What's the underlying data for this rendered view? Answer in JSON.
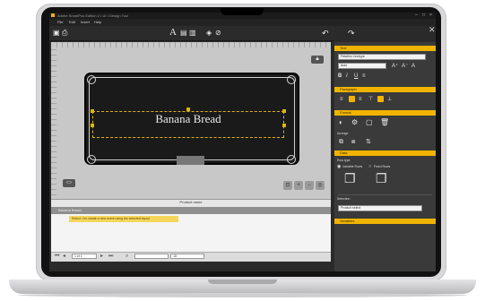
{
  "window": {
    "title": "Adobe SmartPos Edition 2 • UI • Design Tool"
  },
  "menu": {
    "items": [
      "File",
      "Edit",
      "Insert",
      "Help"
    ]
  },
  "label": {
    "text": "Banana Bread"
  },
  "product_panel": {
    "title": "Product name",
    "row": "Banana Bread",
    "hint": "Select • for create a new event using the selected layout"
  },
  "pager": {
    "page": "1 of 1",
    "field": "18"
  },
  "right_panel": {
    "sections": [
      "Text",
      "Paragraph",
      "Format",
      "Data",
      "Variables"
    ],
    "font_family": "Palatino Linotype",
    "font_size": "Auto",
    "arrange_label": "Arrange",
    "row_type_label": "Row type",
    "variable_rows_label": "Variable Rows",
    "fixed_rows_label": "Fixed Rows",
    "selection_label": "Selection",
    "selection_value": "Product select"
  },
  "colors": {
    "accent": "#f0b400",
    "panel": "#3a3a3a",
    "canvas": "#c8c8c8"
  }
}
